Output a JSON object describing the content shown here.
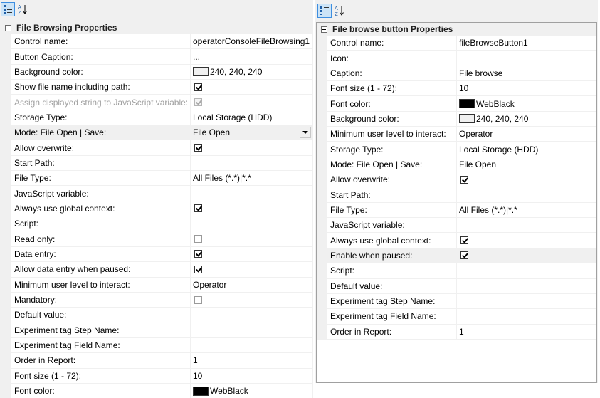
{
  "left": {
    "category": "File Browsing Properties",
    "rows": [
      {
        "name": "Control name:",
        "type": "text",
        "value": "operatorConsoleFileBrowsing1"
      },
      {
        "name": "Button Caption:",
        "type": "text",
        "value": "..."
      },
      {
        "name": "Background color:",
        "type": "color",
        "value": "240, 240, 240",
        "color": "#f0f0f0"
      },
      {
        "name": "Show file name including path:",
        "type": "check",
        "checked": true
      },
      {
        "name": "Assign displayed string to JavaScript variable:",
        "type": "check",
        "checked": true,
        "disabled": true
      },
      {
        "name": "Storage Type:",
        "type": "text",
        "value": "Local Storage (HDD)"
      },
      {
        "name": "Mode: File Open | Save:",
        "type": "dropdown",
        "value": "File Open",
        "highlight": true
      },
      {
        "name": "Allow overwrite:",
        "type": "check",
        "checked": true
      },
      {
        "name": "Start Path:",
        "type": "text",
        "value": ""
      },
      {
        "name": "File Type:",
        "type": "text",
        "value": "All Files (*.*)|*.*"
      },
      {
        "name": "JavaScript variable:",
        "type": "text",
        "value": ""
      },
      {
        "name": "Always use global context:",
        "type": "check",
        "checked": true
      },
      {
        "name": "Script:",
        "type": "text",
        "value": ""
      },
      {
        "name": "Read only:",
        "type": "check",
        "checked": false
      },
      {
        "name": "Data entry:",
        "type": "check",
        "checked": true
      },
      {
        "name": "Allow data entry when paused:",
        "type": "check",
        "checked": true
      },
      {
        "name": "Minimum user level to interact:",
        "type": "text",
        "value": "Operator"
      },
      {
        "name": "Mandatory:",
        "type": "check",
        "checked": false
      },
      {
        "name": "Default value:",
        "type": "text",
        "value": ""
      },
      {
        "name": "Experiment tag Step Name:",
        "type": "text",
        "value": ""
      },
      {
        "name": "Experiment tag Field Name:",
        "type": "text",
        "value": ""
      },
      {
        "name": "Order in Report:",
        "type": "text",
        "value": "1"
      },
      {
        "name": "Font size (1 - 72):",
        "type": "text",
        "value": "10"
      },
      {
        "name": "Font color:",
        "type": "color",
        "value": "WebBlack",
        "color": "#000000"
      }
    ]
  },
  "right": {
    "category": "File browse button Properties",
    "rows": [
      {
        "name": "Control name:",
        "type": "text",
        "value": "fileBrowseButton1"
      },
      {
        "name": "Icon:",
        "type": "text",
        "value": ""
      },
      {
        "name": "Caption:",
        "type": "text",
        "value": "File browse"
      },
      {
        "name": "Font size (1 - 72):",
        "type": "text",
        "value": "10"
      },
      {
        "name": "Font color:",
        "type": "color",
        "value": "WebBlack",
        "color": "#000000"
      },
      {
        "name": "Background color:",
        "type": "color",
        "value": "240, 240, 240",
        "color": "#f0f0f0"
      },
      {
        "name": "Minimum user level to interact:",
        "type": "text",
        "value": "Operator"
      },
      {
        "name": "Storage Type:",
        "type": "text",
        "value": "Local Storage (HDD)"
      },
      {
        "name": "Mode: File Open | Save:",
        "type": "text",
        "value": "File Open"
      },
      {
        "name": "Allow overwrite:",
        "type": "check",
        "checked": true
      },
      {
        "name": "Start Path:",
        "type": "text",
        "value": ""
      },
      {
        "name": "File Type:",
        "type": "text",
        "value": "All Files (*.*)|*.*"
      },
      {
        "name": "JavaScript variable:",
        "type": "text",
        "value": ""
      },
      {
        "name": "Always use global context:",
        "type": "check",
        "checked": true
      },
      {
        "name": "Enable when paused:",
        "type": "check",
        "checked": true,
        "highlight": true
      },
      {
        "name": "Script:",
        "type": "text",
        "value": ""
      },
      {
        "name": "Default value:",
        "type": "text",
        "value": ""
      },
      {
        "name": "Experiment tag Step Name:",
        "type": "text",
        "value": ""
      },
      {
        "name": "Experiment tag Field Name:",
        "type": "text",
        "value": ""
      },
      {
        "name": "Order in Report:",
        "type": "text",
        "value": "1"
      }
    ]
  },
  "toolbar": {
    "categorized_icon": "categorized-view-icon",
    "alphabetical_icon": "alphabetical-sort-icon"
  }
}
